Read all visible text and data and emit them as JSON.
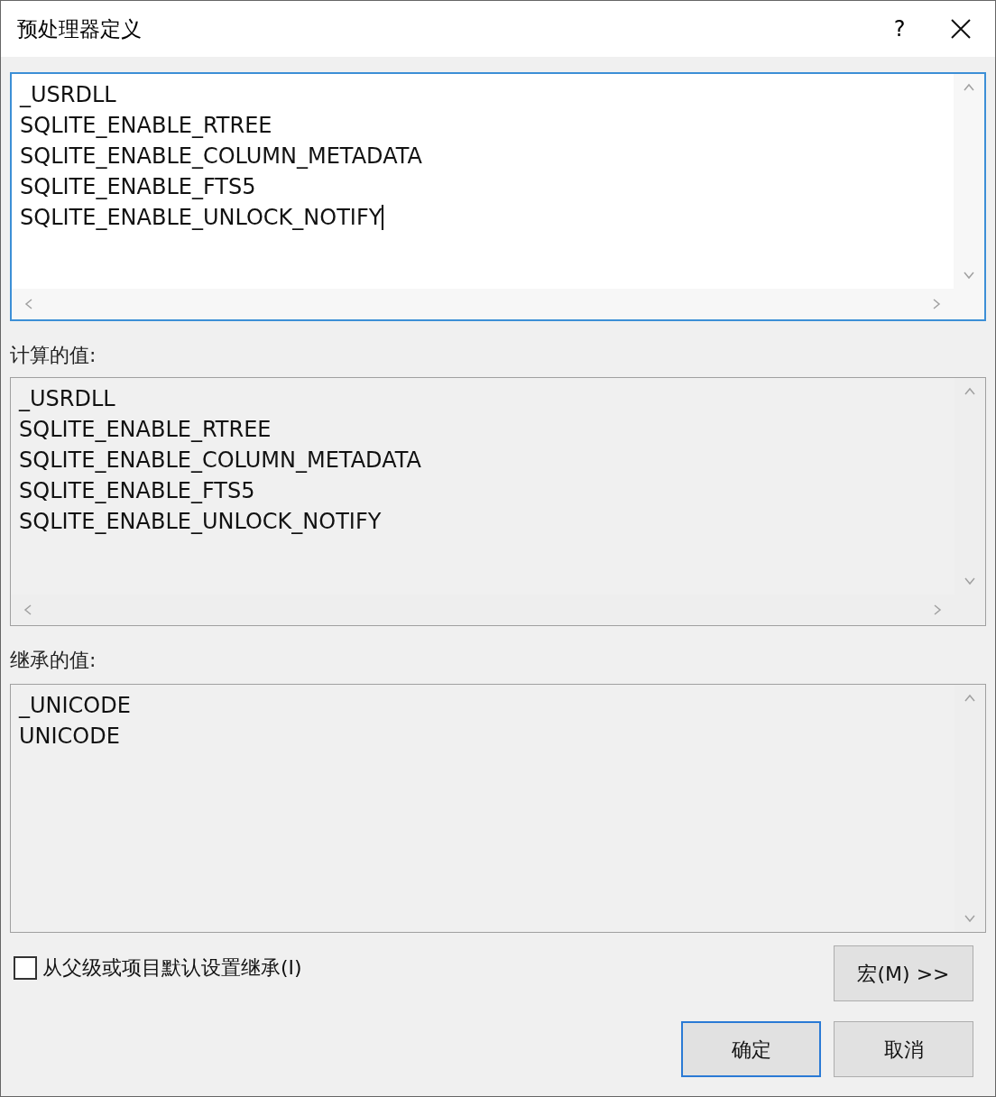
{
  "window": {
    "title": "预处理器定义",
    "help": "?"
  },
  "editor": {
    "focused": true,
    "lines": [
      "_USRDLL",
      "SQLITE_ENABLE_RTREE",
      "SQLITE_ENABLE_COLUMN_METADATA",
      "SQLITE_ENABLE_FTS5",
      "SQLITE_ENABLE_UNLOCK_NOTIFY"
    ]
  },
  "computed": {
    "label": "计算的值:",
    "lines": [
      "_USRDLL",
      "SQLITE_ENABLE_RTREE",
      "SQLITE_ENABLE_COLUMN_METADATA",
      "SQLITE_ENABLE_FTS5",
      "SQLITE_ENABLE_UNLOCK_NOTIFY"
    ]
  },
  "inherited": {
    "label": "继承的值:",
    "lines": [
      "_UNICODE",
      "UNICODE"
    ]
  },
  "inherit_checkbox": {
    "label": "从父级或项目默认设置继承(I)",
    "checked": false
  },
  "buttons": [
    {
      "kind": "macro",
      "label": "宏(M) >>",
      "default": false
    },
    {
      "kind": "ok",
      "label": "确定",
      "default": true
    },
    {
      "kind": "cancel",
      "label": "取消",
      "default": false
    }
  ]
}
